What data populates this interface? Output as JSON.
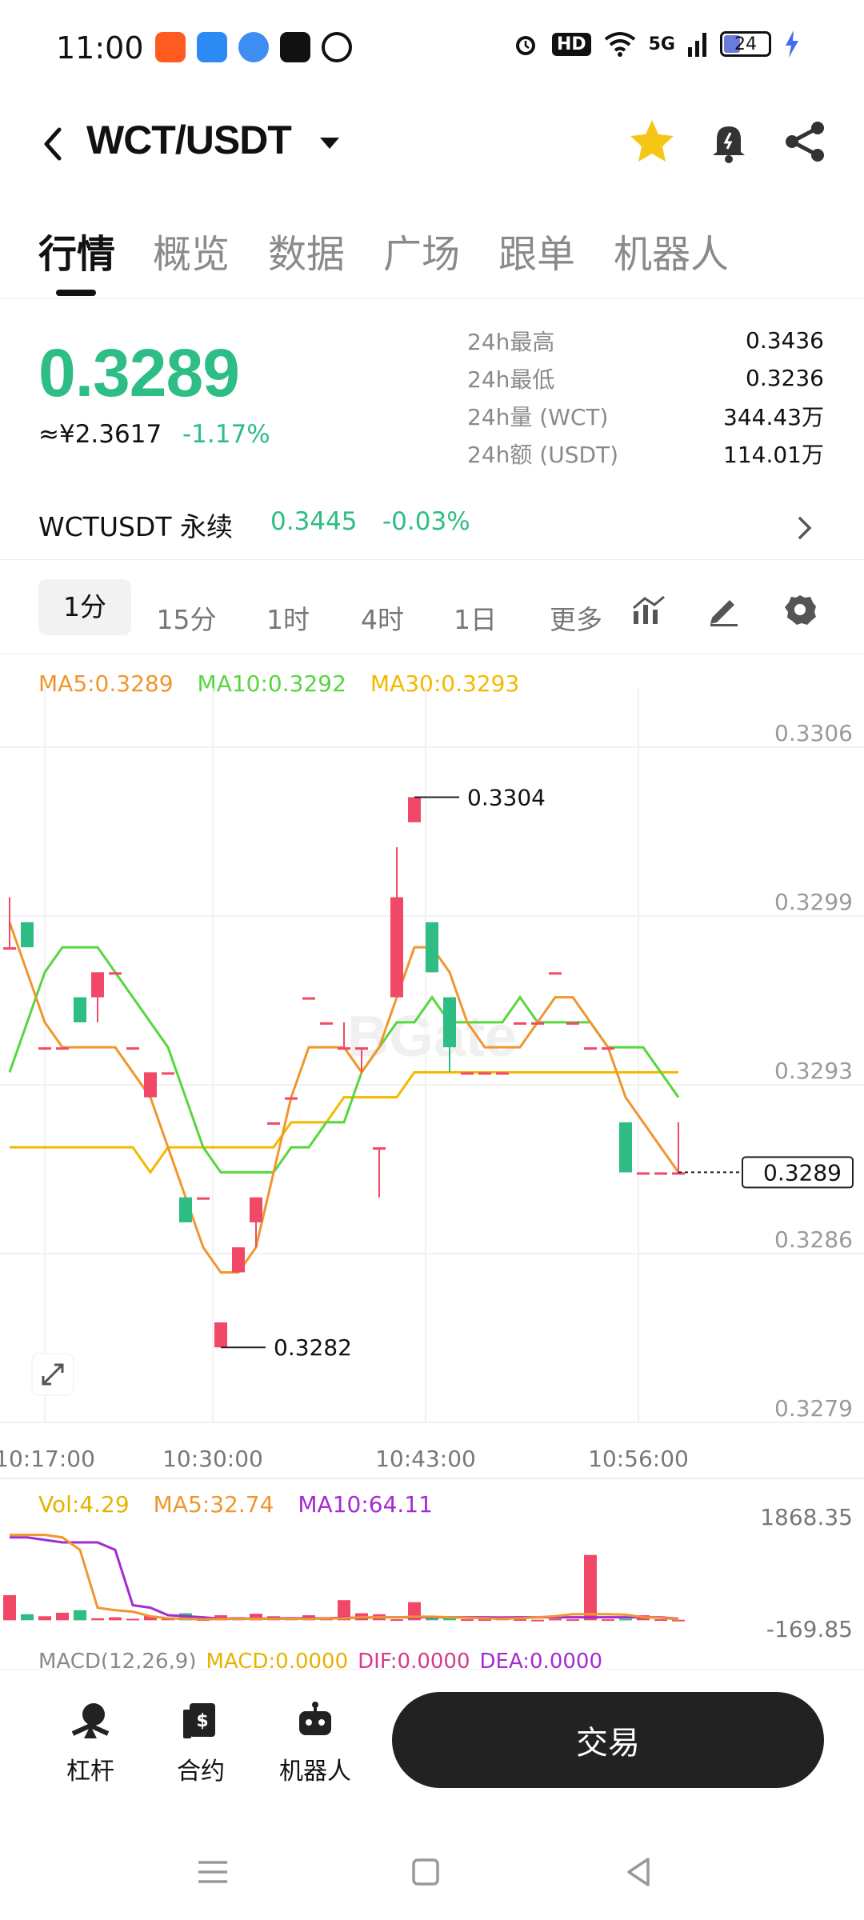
{
  "status_bar": {
    "time": "11:00",
    "network": "5G",
    "hd": "HD",
    "battery": "24"
  },
  "header": {
    "pair": "WCT/USDT",
    "icons": [
      "back-icon",
      "star-icon",
      "alert-bell-icon",
      "share-icon"
    ],
    "star_color": "#f5c518"
  },
  "tabs": [
    "行情",
    "概览",
    "数据",
    "广场",
    "跟单",
    "机器人"
  ],
  "price": {
    "last": "0.3289",
    "cny": "≈¥2.3617",
    "change": "-1.17%",
    "color": "#2ebd85"
  },
  "stats": [
    {
      "label": "24h最高",
      "value": "0.3436"
    },
    {
      "label": "24h最低",
      "value": "0.3236"
    },
    {
      "label": "24h量 (WCT)",
      "value": "344.43万"
    },
    {
      "label": "24h额 (USDT)",
      "value": "114.01万"
    }
  ],
  "perp": {
    "name": "WCTUSDT 永续",
    "price": "0.3445",
    "change": "-0.03%"
  },
  "intervals": [
    "1分",
    "15分",
    "1时",
    "4时",
    "1日",
    "更多"
  ],
  "ma_legend": {
    "ma5": "MA5:0.3289",
    "ma10": "MA10:0.3292",
    "ma30": "MA30:0.3293",
    "ma5_color": "#f0962e",
    "ma10_color": "#57d63f",
    "ma30_color": "#f5b800"
  },
  "vol_legend": {
    "vol": "Vol:4.29",
    "ma5": "MA5:32.74",
    "ma10": "MA10:64.11",
    "vol_color": "#e6b200",
    "ma5_color": "#f0962e",
    "ma10_color": "#a42bd1"
  },
  "macd_legend": {
    "label": "MACD(12,26,9)",
    "macd": "MACD:0.0000",
    "dif": "DIF:0.0000",
    "dea": "DEA:0.0000"
  },
  "chart_data": {
    "type": "candlestick",
    "y_ticks": [
      "0.3306",
      "0.3299",
      "0.3293",
      "0.3286",
      "0.3279"
    ],
    "ylim": [
      0.3279,
      0.3306
    ],
    "x_ticks": [
      "10:17:00",
      "10:30:00",
      "10:43:00",
      "10:56:00"
    ],
    "current_price_label": "0.3289",
    "high_label": "0.3304",
    "low_label": "0.3282",
    "up_color": "#f04866",
    "down_color": "#2ebd85",
    "candles": [
      {
        "o": 0.3298,
        "h": 0.33,
        "l": 0.3298,
        "c": 0.3298
      },
      {
        "o": 0.3299,
        "h": 0.3299,
        "l": 0.3298,
        "c": 0.3298
      },
      {
        "o": 0.3294,
        "h": 0.3294,
        "l": 0.3294,
        "c": 0.3294
      },
      {
        "o": 0.3294,
        "h": 0.3294,
        "l": 0.3294,
        "c": 0.3294
      },
      {
        "o": 0.3296,
        "h": 0.3296,
        "l": 0.3295,
        "c": 0.3295
      },
      {
        "o": 0.3296,
        "h": 0.3297,
        "l": 0.3295,
        "c": 0.3297
      },
      {
        "o": 0.3297,
        "h": 0.3297,
        "l": 0.3297,
        "c": 0.3297
      },
      {
        "o": 0.3294,
        "h": 0.3294,
        "l": 0.3294,
        "c": 0.3294
      },
      {
        "o": 0.3292,
        "h": 0.3293,
        "l": 0.3292,
        "c": 0.3293
      },
      {
        "o": 0.3293,
        "h": 0.3293,
        "l": 0.3293,
        "c": 0.3293
      },
      {
        "o": 0.3288,
        "h": 0.3288,
        "l": 0.3287,
        "c": 0.3287
      },
      {
        "o": 0.3288,
        "h": 0.3288,
        "l": 0.3288,
        "c": 0.3288
      },
      {
        "o": 0.3282,
        "h": 0.3283,
        "l": 0.3282,
        "c": 0.3283
      },
      {
        "o": 0.3285,
        "h": 0.3286,
        "l": 0.3285,
        "c": 0.3286
      },
      {
        "o": 0.3287,
        "h": 0.3288,
        "l": 0.3286,
        "c": 0.3288
      },
      {
        "o": 0.3291,
        "h": 0.3291,
        "l": 0.3291,
        "c": 0.3291
      },
      {
        "o": 0.3292,
        "h": 0.3292,
        "l": 0.3292,
        "c": 0.3292
      },
      {
        "o": 0.3296,
        "h": 0.3296,
        "l": 0.3296,
        "c": 0.3296
      },
      {
        "o": 0.3295,
        "h": 0.3295,
        "l": 0.3295,
        "c": 0.3295
      },
      {
        "o": 0.3294,
        "h": 0.3295,
        "l": 0.3294,
        "c": 0.3294
      },
      {
        "o": 0.3294,
        "h": 0.3294,
        "l": 0.3293,
        "c": 0.3294
      },
      {
        "o": 0.329,
        "h": 0.329,
        "l": 0.3288,
        "c": 0.329
      },
      {
        "o": 0.3296,
        "h": 0.3302,
        "l": 0.3296,
        "c": 0.33
      },
      {
        "o": 0.3303,
        "h": 0.3304,
        "l": 0.3303,
        "c": 0.3304
      },
      {
        "o": 0.3299,
        "h": 0.3299,
        "l": 0.3297,
        "c": 0.3297
      },
      {
        "o": 0.3296,
        "h": 0.3296,
        "l": 0.3293,
        "c": 0.3294
      },
      {
        "o": 0.3293,
        "h": 0.3293,
        "l": 0.3293,
        "c": 0.3293
      },
      {
        "o": 0.3293,
        "h": 0.3293,
        "l": 0.3293,
        "c": 0.3293
      },
      {
        "o": 0.3293,
        "h": 0.3293,
        "l": 0.3293,
        "c": 0.3293
      },
      {
        "o": 0.3295,
        "h": 0.3295,
        "l": 0.3295,
        "c": 0.3295
      },
      {
        "o": 0.3295,
        "h": 0.3295,
        "l": 0.3295,
        "c": 0.3295
      },
      {
        "o": 0.3297,
        "h": 0.3297,
        "l": 0.3297,
        "c": 0.3297
      },
      {
        "o": 0.3295,
        "h": 0.3295,
        "l": 0.3295,
        "c": 0.3295
      },
      {
        "o": 0.3294,
        "h": 0.3294,
        "l": 0.3294,
        "c": 0.3294
      },
      {
        "o": 0.3294,
        "h": 0.3294,
        "l": 0.3294,
        "c": 0.3294
      },
      {
        "o": 0.3291,
        "h": 0.3291,
        "l": 0.3289,
        "c": 0.3289
      },
      {
        "o": 0.3289,
        "h": 0.3289,
        "l": 0.3289,
        "c": 0.3289
      },
      {
        "o": 0.3289,
        "h": 0.3289,
        "l": 0.3289,
        "c": 0.3289
      },
      {
        "o": 0.3289,
        "h": 0.3291,
        "l": 0.3289,
        "c": 0.3289
      }
    ],
    "ma5": [
      0.3299,
      0.3297,
      0.3295,
      0.3294,
      0.3294,
      0.3294,
      0.3294,
      0.3293,
      0.3292,
      0.329,
      0.3288,
      0.3286,
      0.3285,
      0.3285,
      0.3286,
      0.3289,
      0.3292,
      0.3294,
      0.3294,
      0.3294,
      0.3293,
      0.3294,
      0.3296,
      0.3298,
      0.3298,
      0.3297,
      0.3295,
      0.3294,
      0.3294,
      0.3294,
      0.3295,
      0.3296,
      0.3296,
      0.3295,
      0.3294,
      0.3292,
      0.3291,
      0.329,
      0.3289
    ],
    "ma10": [
      0.3293,
      0.3295,
      0.3297,
      0.3298,
      0.3298,
      0.3298,
      0.3297,
      0.3296,
      0.3295,
      0.3294,
      0.3292,
      0.329,
      0.3289,
      0.3289,
      0.3289,
      0.3289,
      0.329,
      0.329,
      0.3291,
      0.3291,
      0.3293,
      0.3294,
      0.3295,
      0.3295,
      0.3296,
      0.3295,
      0.3295,
      0.3295,
      0.3295,
      0.3296,
      0.3295,
      0.3295,
      0.3295,
      0.3295,
      0.3294,
      0.3294,
      0.3294,
      0.3293,
      0.3292
    ],
    "ma30": [
      0.329,
      0.329,
      0.329,
      0.329,
      0.329,
      0.329,
      0.329,
      0.329,
      0.3289,
      0.329,
      0.329,
      0.329,
      0.329,
      0.329,
      0.329,
      0.329,
      0.3291,
      0.3291,
      0.3291,
      0.3292,
      0.3292,
      0.3292,
      0.3292,
      0.3293,
      0.3293,
      0.3293,
      0.3293,
      0.3293,
      0.3293,
      0.3293,
      0.3293,
      0.3293,
      0.3293,
      0.3293,
      0.3293,
      0.3293,
      0.3293,
      0.3293,
      0.3293
    ],
    "volume": {
      "y_ticks": [
        "1868.35",
        "-169.85"
      ],
      "ylim": [
        -169.85,
        1868.35
      ],
      "bars": [
        500,
        120,
        80,
        150,
        200,
        40,
        60,
        30,
        90,
        40,
        140,
        20,
        100,
        60,
        130,
        80,
        60,
        100,
        50,
        400,
        140,
        120,
        20,
        360,
        80,
        60,
        20,
        20,
        60,
        20,
        10,
        30,
        20,
        1300,
        20,
        30,
        100,
        20,
        10
      ],
      "ma5": [
        1700,
        1700,
        1700,
        1650,
        1400,
        250,
        200,
        170,
        80,
        40,
        30,
        20,
        25,
        30,
        30,
        30,
        30,
        30,
        35,
        40,
        60,
        60,
        60,
        70,
        70,
        60,
        50,
        40,
        30,
        40,
        60,
        80,
        120,
        120,
        120,
        110,
        60,
        50,
        20
      ],
      "ma10": [
        1650,
        1650,
        1600,
        1550,
        1550,
        1550,
        1400,
        300,
        250,
        100,
        80,
        60,
        30,
        40,
        30,
        40,
        40,
        40,
        40,
        50,
        50,
        60,
        60,
        60,
        60,
        60,
        60,
        60,
        55,
        60,
        60,
        60,
        60,
        60,
        60,
        60,
        60,
        60,
        30
      ]
    }
  },
  "actions": [
    {
      "label": "杠杆",
      "icon": "leverage-icon"
    },
    {
      "label": "合约",
      "icon": "contract-icon"
    },
    {
      "label": "机器人",
      "icon": "robot-icon"
    }
  ],
  "trade_button": "交易",
  "nav": [
    "menu-icon",
    "home-icon",
    "back-icon"
  ]
}
